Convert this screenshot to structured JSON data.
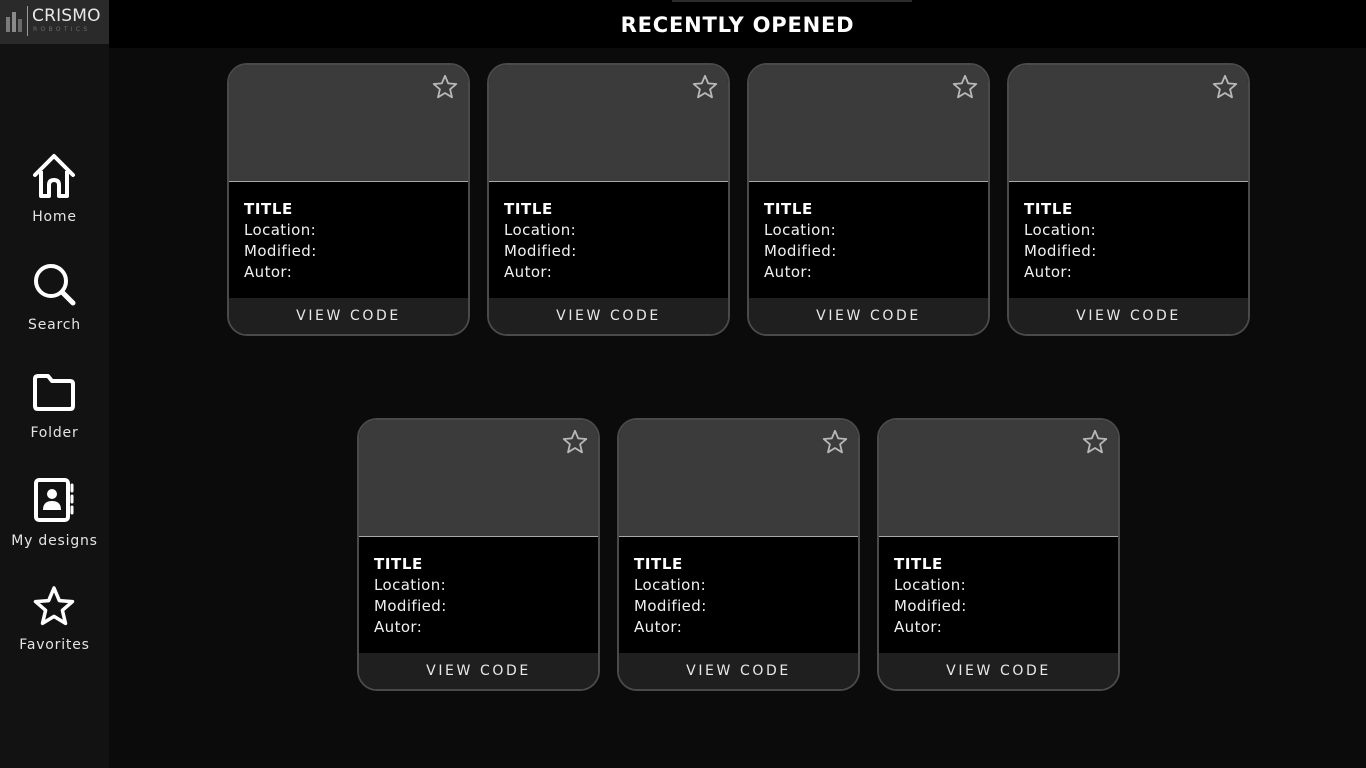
{
  "brand": {
    "name": "CRISMO",
    "tagline": "ROBOTICS"
  },
  "nav": [
    {
      "label": "Home",
      "icon": "home-icon"
    },
    {
      "label": "Search",
      "icon": "search-icon"
    },
    {
      "label": "Folder",
      "icon": "folder-icon"
    },
    {
      "label": "My designs",
      "icon": "contact-book-icon"
    },
    {
      "label": "Favorites",
      "icon": "star-icon"
    }
  ],
  "header": {
    "title": "RECENTLY OPENED"
  },
  "cards": [
    {
      "title": "TITLE",
      "location": "Location:",
      "modified": "Modified:",
      "author": "Autor:",
      "action": "VIEW CODE"
    },
    {
      "title": "TITLE",
      "location": "Location:",
      "modified": "Modified:",
      "author": "Autor:",
      "action": "VIEW CODE"
    },
    {
      "title": "TITLE",
      "location": "Location:",
      "modified": "Modified:",
      "author": "Autor:",
      "action": "VIEW CODE"
    },
    {
      "title": "TITLE",
      "location": "Location:",
      "modified": "Modified:",
      "author": "Autor:",
      "action": "VIEW CODE"
    },
    {
      "title": "TITLE",
      "location": "Location:",
      "modified": "Modified:",
      "author": "Autor:",
      "action": "VIEW CODE"
    },
    {
      "title": "TITLE",
      "location": "Location:",
      "modified": "Modified:",
      "author": "Autor:",
      "action": "VIEW CODE"
    },
    {
      "title": "TITLE",
      "location": "Location:",
      "modified": "Modified:",
      "author": "Autor:",
      "action": "VIEW CODE"
    }
  ],
  "colors": {
    "background": "#0b0b0b",
    "sidebar": "#121212",
    "thumbnail": "#3b3b3b",
    "card_border": "#4a4a4a",
    "button": "#1f1f1f"
  }
}
